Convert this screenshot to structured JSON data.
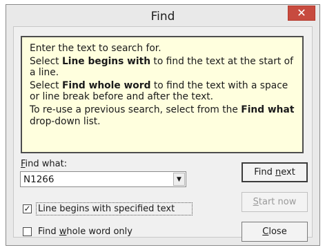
{
  "window": {
    "title": "Find",
    "close_glyph": "✕"
  },
  "info": {
    "line1": "Enter the text to search for.",
    "line2_pre": "Select ",
    "line2_bold": "Line begins with",
    "line2_post": " to find the text at the start of a line.",
    "line3_pre": "Select ",
    "line3_bold": "Find whole word",
    "line3_post": " to find the text with a space or line break before and after the text.",
    "line4_pre": "To re-use a previous search, select from the ",
    "line4_bold": "Find what",
    "line4_post": " drop-down list.",
    "background": "#ffffde"
  },
  "find_what": {
    "label_first": "F",
    "label_rest": "ind what:",
    "value": "N1266",
    "arrow_icon": "chevron-down-icon"
  },
  "options": {
    "line_begins": {
      "label": "Line begins with specified text",
      "checked": true,
      "mark": "✓"
    },
    "whole_word": {
      "label_pre": "Find ",
      "label_u": "w",
      "label_post": "hole word only",
      "checked": false
    }
  },
  "buttons": {
    "find_next": {
      "pre": "Find ",
      "u": "n",
      "post": "ext"
    },
    "start_now": {
      "pre": "",
      "u": "S",
      "post": "tart now",
      "enabled": false
    },
    "close": {
      "pre": "",
      "u": "C",
      "post": "lose"
    }
  },
  "colors": {
    "close_button": "#c74b3f",
    "disabled_text": "#9a9a9a"
  }
}
